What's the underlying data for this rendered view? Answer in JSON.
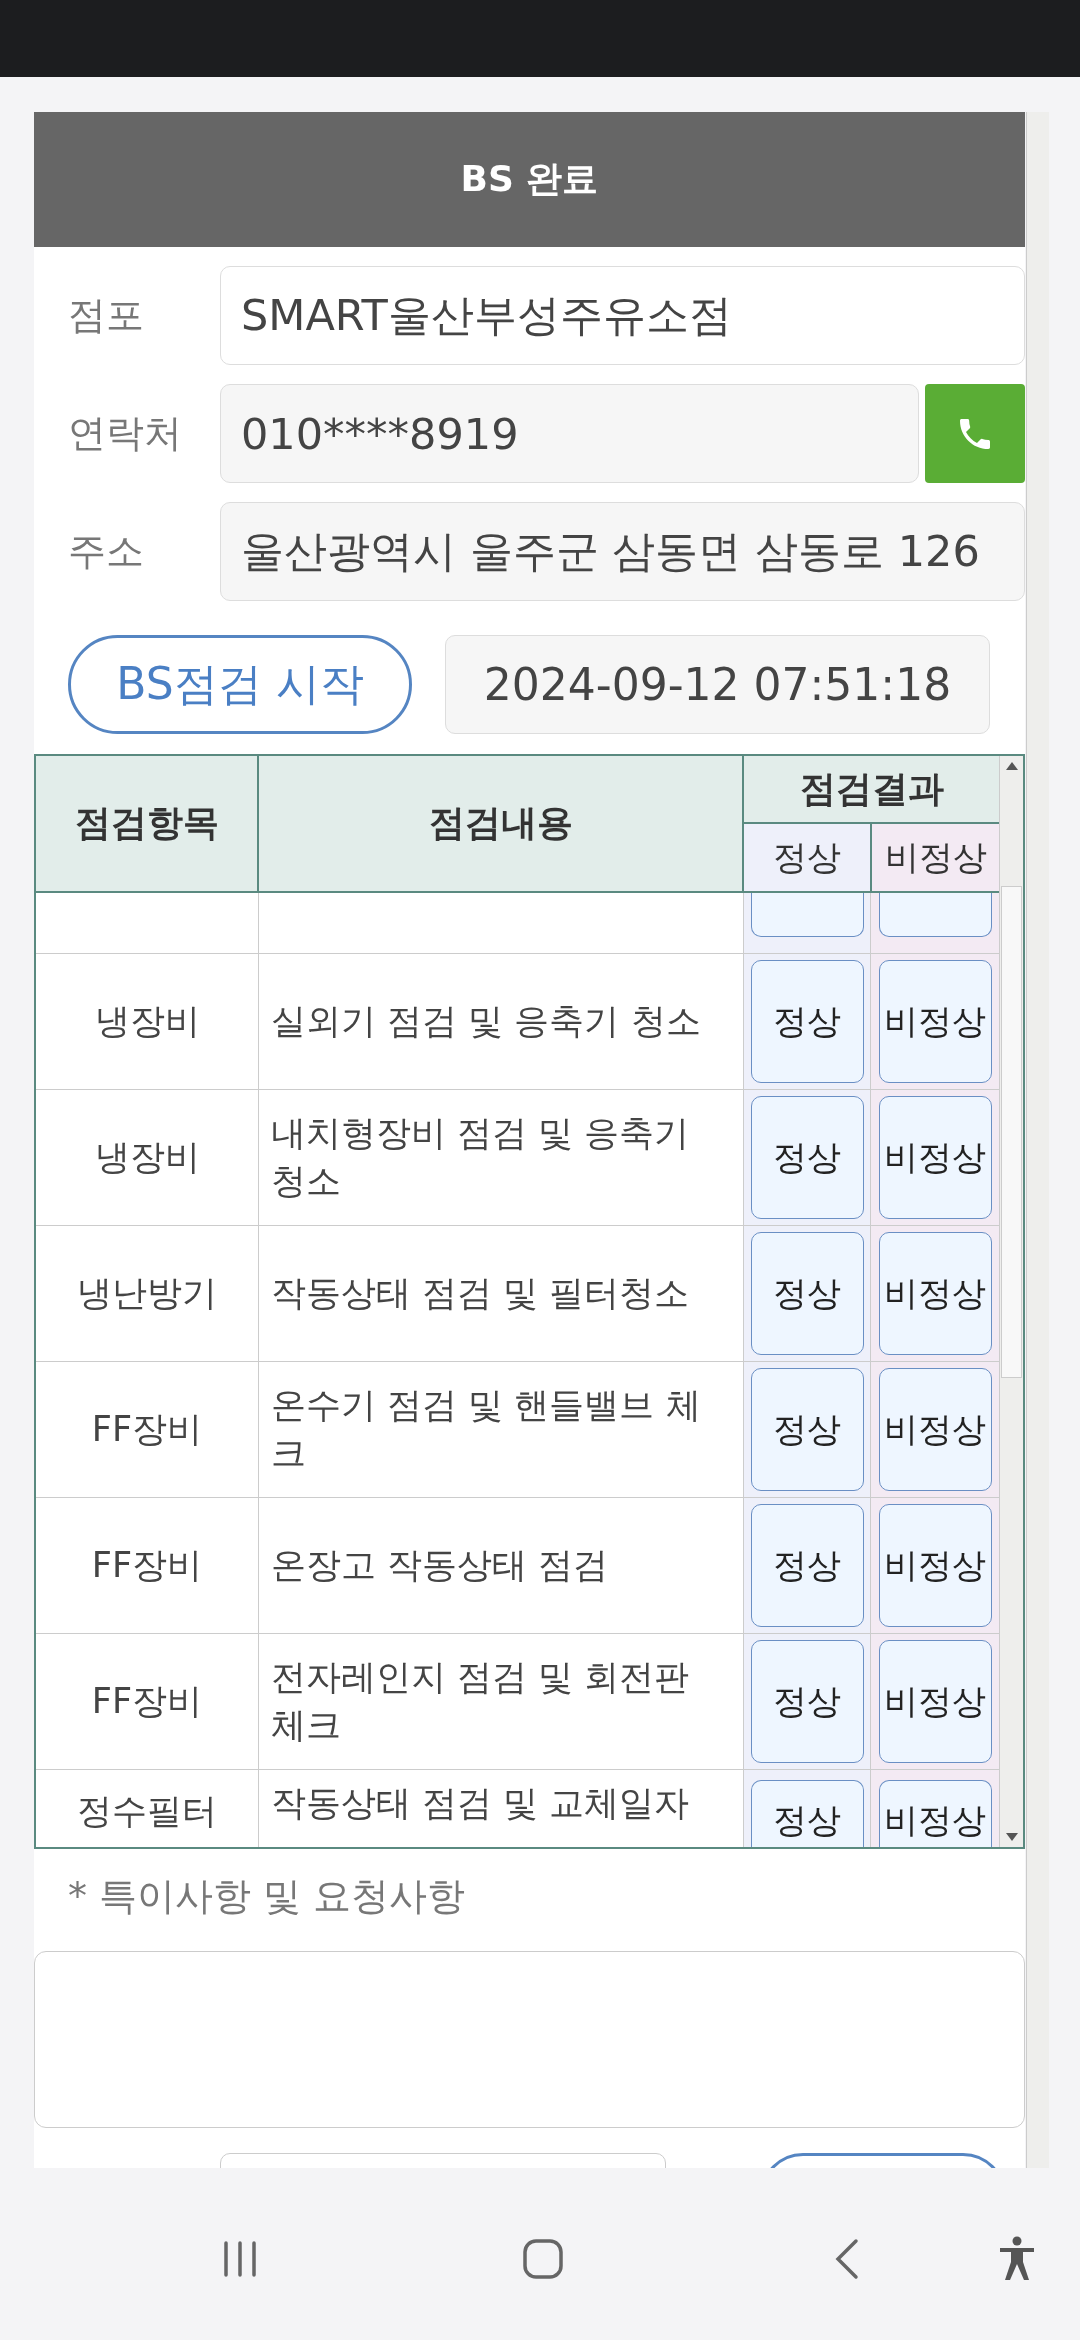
{
  "dialog": {
    "title": "BS 완료"
  },
  "fields": [
    {
      "kind": "text",
      "label": "점포",
      "value": "SMART울산부성주유소점"
    },
    {
      "kind": "phone",
      "label": "연락처",
      "value": "010****8919"
    },
    {
      "kind": "text",
      "label": "주소",
      "value": "울산광역시 울주군 삼동면 삼동로 126"
    }
  ],
  "start_button": "BS점검 시작",
  "start_time": "2024-09-12 07:51:18",
  "table": {
    "columns": [
      "점검항목",
      "점검내용",
      "점검결과"
    ],
    "result_columns": [
      "정상",
      "비정상"
    ],
    "rows": [
      {
        "item": "냉장비",
        "content": "실외기 점검 및 응축기 청소",
        "normal": "정상",
        "abnormal": "비정상"
      },
      {
        "item": "냉장비",
        "content": "내치형장비 점검 및 응축기 청소",
        "normal": "정상",
        "abnormal": "비정상"
      },
      {
        "item": "냉난방기",
        "content": "작동상태 점검 및 필터청소",
        "normal": "정상",
        "abnormal": "비정상"
      },
      {
        "item": "FF장비",
        "content": "온수기 점검 및 핸들밸브 체크",
        "normal": "정상",
        "abnormal": "비정상"
      },
      {
        "item": "FF장비",
        "content": "온장고 작동상태 점검",
        "normal": "정상",
        "abnormal": "비정상"
      },
      {
        "item": "FF장비",
        "content": "전자레인지 점검 및 회전판 체크",
        "normal": "정상",
        "abnormal": "비정상"
      },
      {
        "item": "정수필터",
        "content": "작동상태 점검 및 교체일자",
        "normal": "정상",
        "abnormal": "비정상"
      }
    ]
  },
  "notes": {
    "label": "* 특이사항 및 요청사항"
  }
}
